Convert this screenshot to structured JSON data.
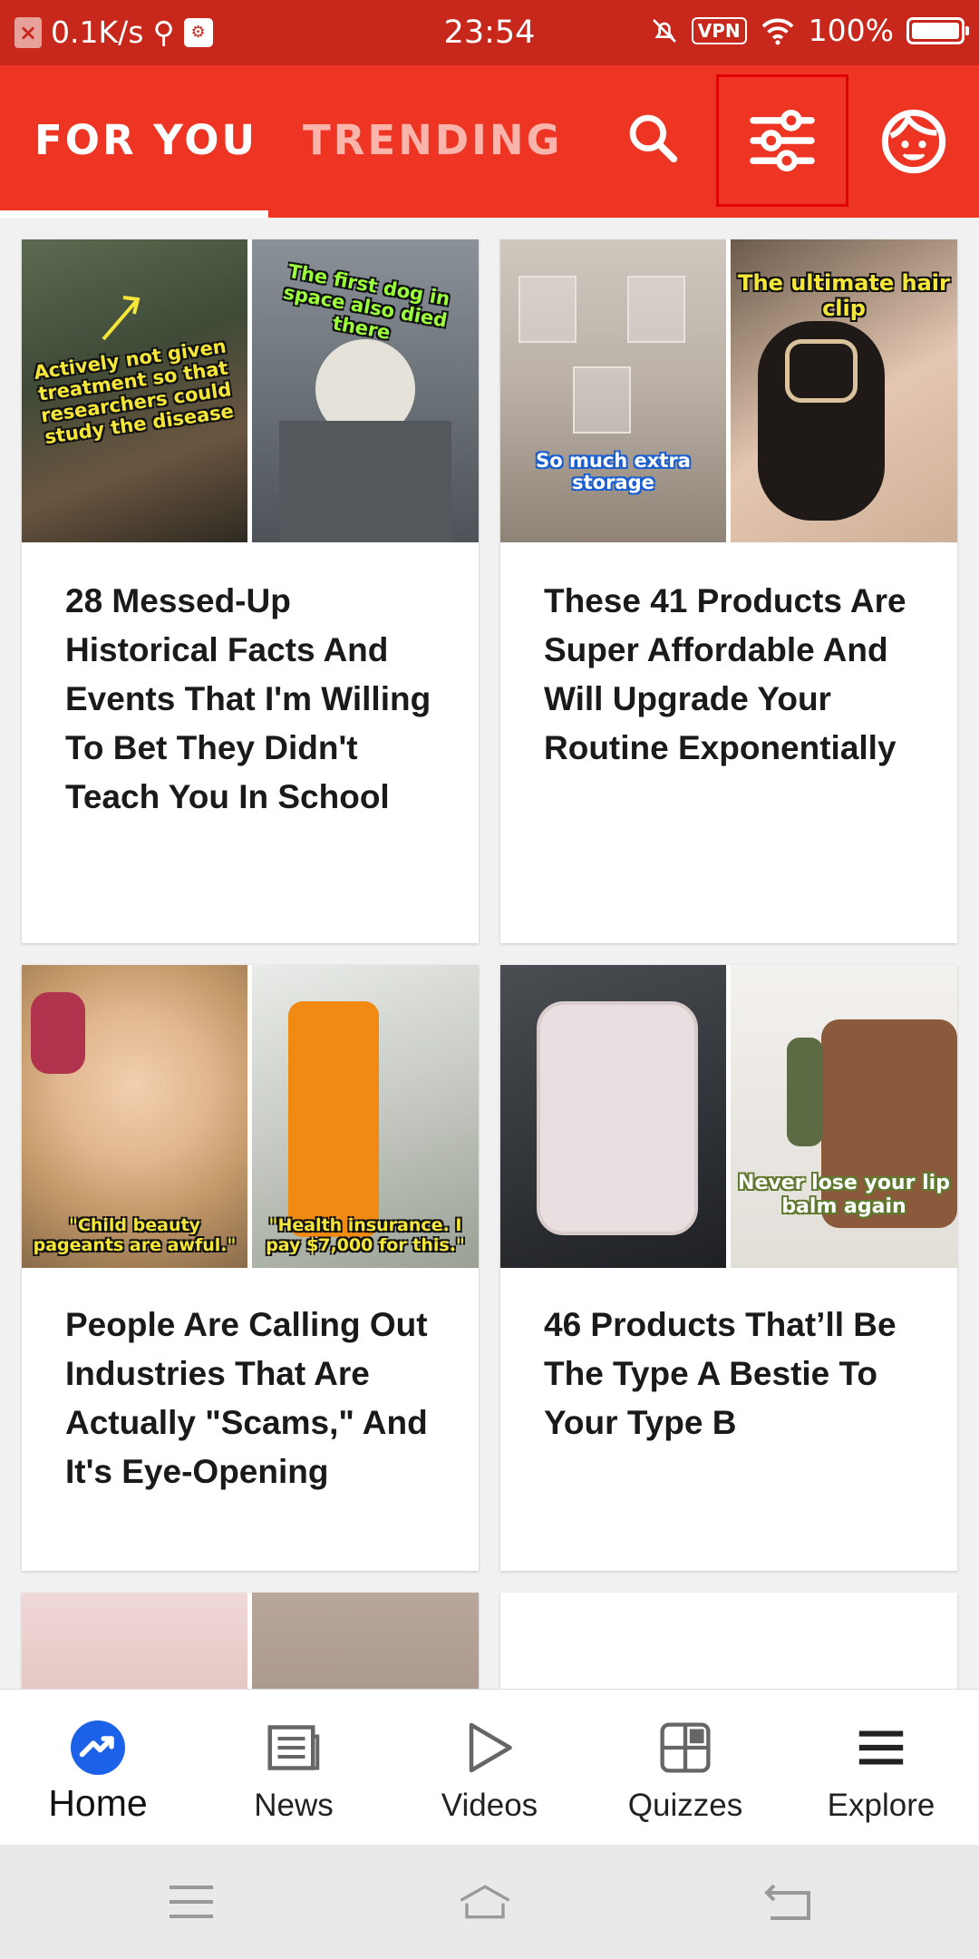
{
  "status_bar": {
    "network_speed": "0.1K/s",
    "time": "23:54",
    "vpn_label": "VPN",
    "battery": "100%"
  },
  "header": {
    "tabs": [
      {
        "label": "FOR YOU",
        "active": true
      },
      {
        "label": "TRENDING",
        "active": false
      }
    ],
    "icons": [
      "search-icon",
      "filter-sliders-icon",
      "profile-face-icon"
    ]
  },
  "feed": [
    {
      "title": "28 Messed-Up Historical Facts And Events That I'm Willing To Bet They Didn't Teach You In School",
      "captions": [
        "Actively not given treatment so that researchers could study the disease",
        "The first dog in space also died there"
      ]
    },
    {
      "title": "These 41 Products Are Super Affordable And Will Upgrade Your Routine Exponentially",
      "captions": [
        "So much extra storage",
        "The ultimate hair clip"
      ]
    },
    {
      "title": "People Are Calling Out Industries That Are Actually \"Scams,\" And It's Eye-Opening",
      "captions": [
        "\"Child beauty pageants are awful.\"",
        "\"Health insurance. I pay $7,000 for this.\""
      ]
    },
    {
      "title": "46 Products That’ll Be The Type A Bestie To Your Type B",
      "captions": [
        "",
        "Never lose your lip balm again"
      ]
    }
  ],
  "bottom_nav": [
    {
      "label": "Home",
      "icon": "trending-icon",
      "active": true
    },
    {
      "label": "News",
      "icon": "news-icon",
      "active": false
    },
    {
      "label": "Videos",
      "icon": "play-icon",
      "active": false
    },
    {
      "label": "Quizzes",
      "icon": "quizzes-grid-icon",
      "active": false
    },
    {
      "label": "Explore",
      "icon": "menu-icon",
      "active": false
    }
  ],
  "colors": {
    "brand_red": "#ee3524",
    "status_bar_red": "#c8281c",
    "active_nav_blue": "#1c62e8",
    "caption_yellow": "#f5e63a",
    "caption_green": "#9bff3a"
  }
}
